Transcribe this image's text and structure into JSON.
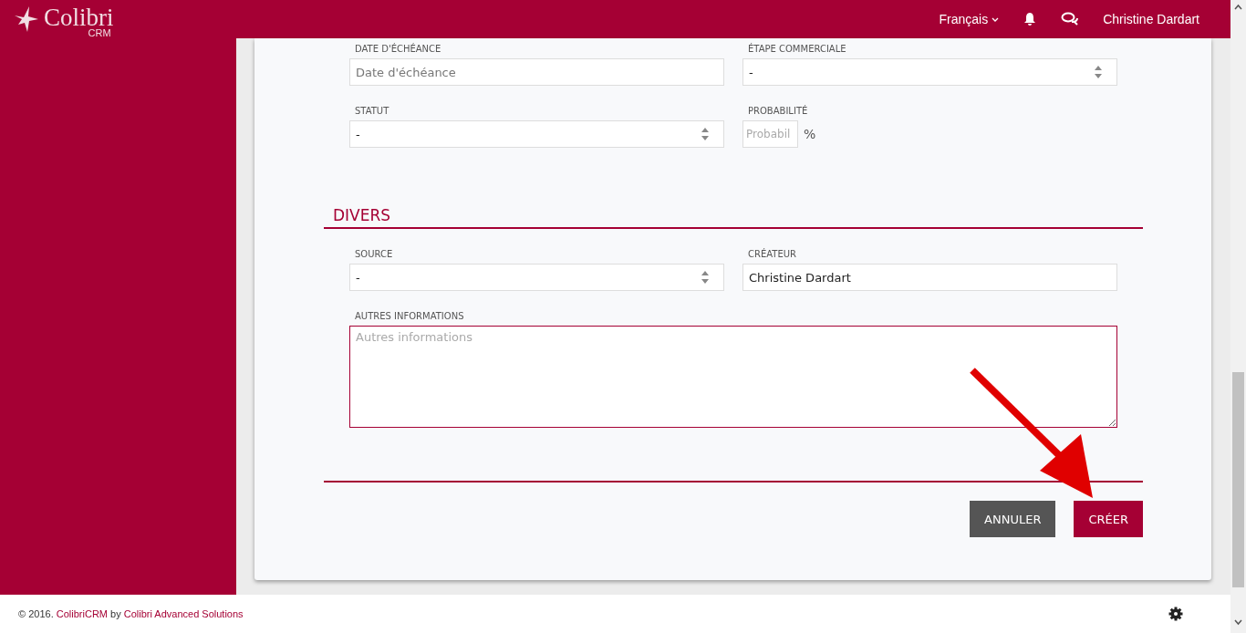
{
  "header": {
    "logo_name": "Colibri",
    "logo_sub": "CRM",
    "language": "Français",
    "user": "Christine Dardart"
  },
  "sections": [
    {
      "fields": [
        {
          "kind": "text",
          "label": "DATE D'ÉCHÉANCE",
          "placeholder": "Date d'échéance"
        },
        {
          "kind": "select",
          "label": "ÉTAPE COMMERCIALE",
          "value": "-"
        },
        {
          "kind": "select",
          "label": "STATUT",
          "value": "-"
        },
        {
          "kind": "percent",
          "label": "PROBABILITÉ",
          "placeholder": "Probabil",
          "unit": "%"
        }
      ]
    },
    {
      "title": "DIVERS",
      "fields": [
        {
          "kind": "select",
          "label": "SOURCE",
          "value": "-"
        },
        {
          "kind": "text",
          "label": "CRÉATEUR",
          "value": "Christine Dardart"
        },
        {
          "kind": "textarea",
          "label": "AUTRES INFORMATIONS",
          "placeholder": "Autres informations"
        }
      ]
    }
  ],
  "buttons": [
    {
      "label": "ANNULER",
      "kind": "secondary"
    },
    {
      "label": "CRÉER",
      "kind": "primary"
    }
  ],
  "footer": {
    "prefix": "© 2016.",
    "brand_link": "ColibriCRM",
    "by": "by",
    "company_link": "Colibri Advanced Solutions"
  }
}
